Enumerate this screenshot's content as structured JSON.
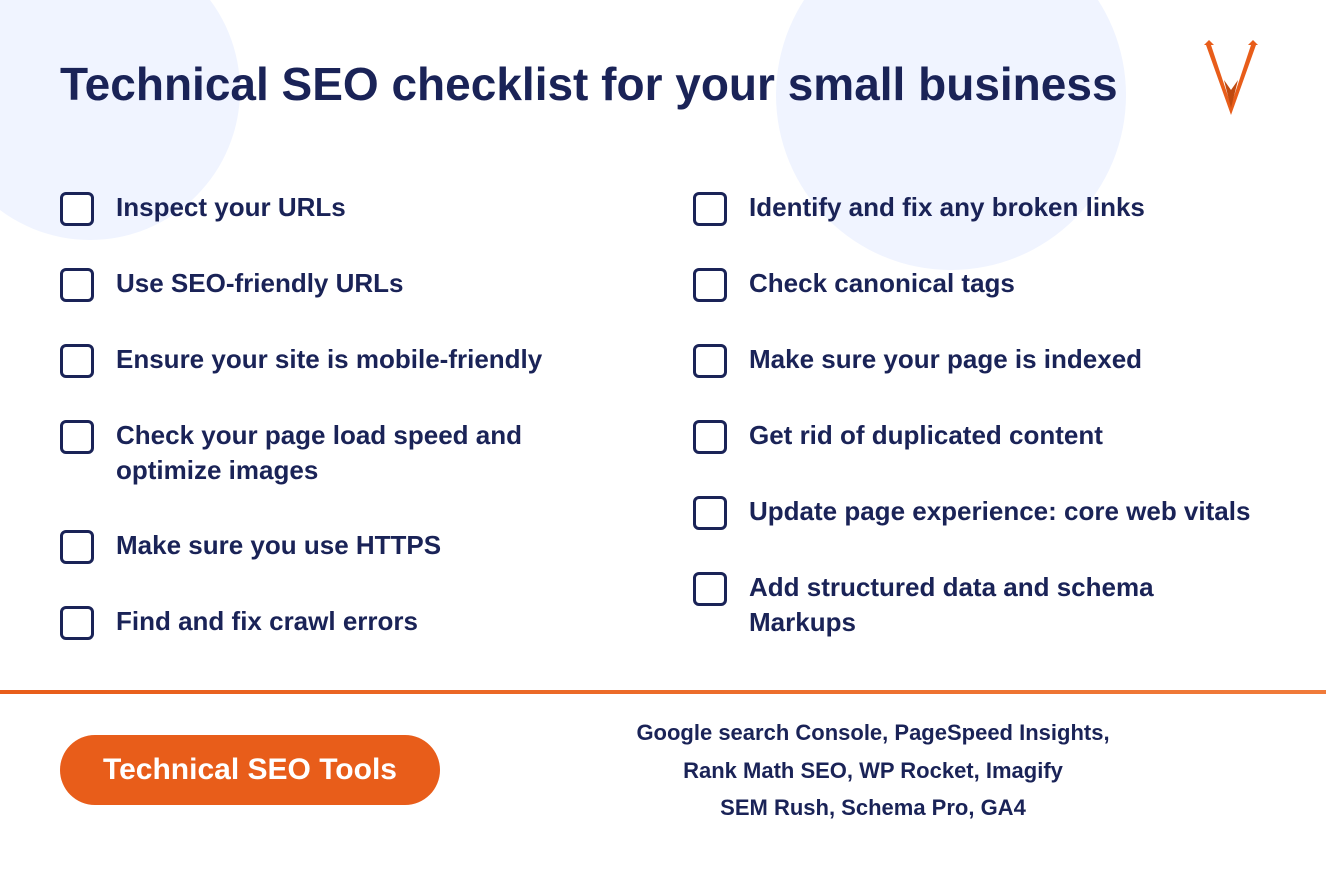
{
  "page": {
    "title": "Technical SEO checklist for your small business",
    "background_color": "#ffffff",
    "accent_color": "#e85d1a",
    "dark_color": "#1a2357"
  },
  "logo": {
    "alt": "W logo icon"
  },
  "checklist": {
    "left_column": [
      {
        "id": 1,
        "text": "Inspect your URLs"
      },
      {
        "id": 2,
        "text": "Use SEO-friendly URLs"
      },
      {
        "id": 3,
        "text": "Ensure your site is mobile-friendly"
      },
      {
        "id": 4,
        "text": "Check your page load speed and optimize images"
      },
      {
        "id": 5,
        "text": "Make sure you use HTTPS"
      },
      {
        "id": 6,
        "text": "Find and fix crawl errors"
      }
    ],
    "right_column": [
      {
        "id": 7,
        "text": "Identify and fix any broken links"
      },
      {
        "id": 8,
        "text": "Check canonical tags"
      },
      {
        "id": 9,
        "text": "Make sure your page is indexed"
      },
      {
        "id": 10,
        "text": "Get rid of duplicated content"
      },
      {
        "id": 11,
        "text": "Update page experience: core web vitals"
      },
      {
        "id": 12,
        "text": "Add structured data and schema Markups"
      }
    ]
  },
  "footer": {
    "badge_label": "Technical SEO Tools",
    "tools_line1": "Google search Console, PageSpeed Insights,",
    "tools_line2": "Rank Math SEO, WP Rocket, Imagify",
    "tools_line3": "SEM Rush, Schema Pro, GA4"
  }
}
